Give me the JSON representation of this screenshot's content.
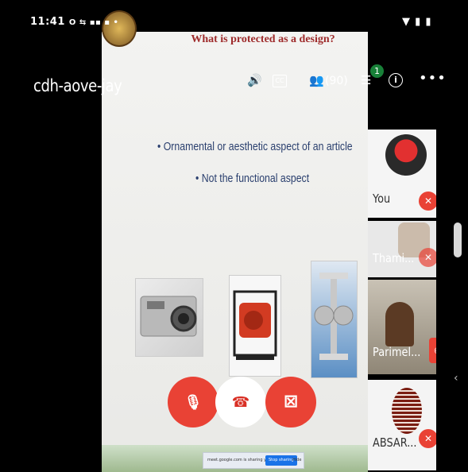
{
  "status_bar": {
    "time": "11:41",
    "left_icons": "O ⇆ ▪▪ ▪ •",
    "right_icons": "▼ ▮ ▮"
  },
  "app_bar": {
    "meeting_code": "cdh-aove-jay",
    "speaker_glyph": "🔊",
    "cc_label": "CC",
    "people_glyph": "👥",
    "participant_count": "(90)",
    "chat_glyph": "☰",
    "chat_badge": "1",
    "info_glyph": "i",
    "more_glyph": "•••"
  },
  "slide": {
    "title": "What is protected as a design?",
    "bullets": [
      "• Ornamental or aesthetic aspect of an article",
      "• Not the functional aspect"
    ]
  },
  "participants": [
    {
      "name": "You",
      "muted": true
    },
    {
      "name": "Thami...",
      "muted": true
    },
    {
      "name": "Parimel...",
      "muted": false
    },
    {
      "name": "ABSAR...",
      "muted": true
    }
  ],
  "controls": {
    "mic_glyph": "🎙",
    "end_call_glyph": "☎",
    "camera_glyph": "⊠"
  },
  "share_banner": {
    "text": "meet.google.com is sharing your screen",
    "stop_label": "Stop sharing",
    "hide_label": "Hide"
  },
  "colors": {
    "danger": "#e94235",
    "title_red": "#9e2b2b",
    "bullet_blue": "#2a3f6e",
    "badge_green": "#188038"
  }
}
